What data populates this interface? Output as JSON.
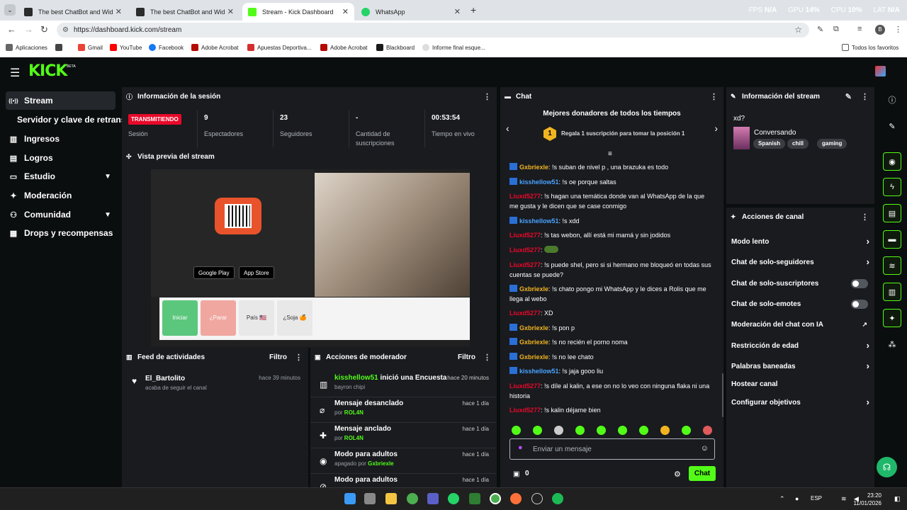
{
  "browser": {
    "tabs": [
      {
        "title": "The best ChatBot and Widgets",
        "icon_color": "#2b2b2b",
        "active": false
      },
      {
        "title": "The best ChatBot and Widgets",
        "icon_color": "#2b2b2b",
        "active": false
      },
      {
        "title": "Stream - Kick Dashboard",
        "icon_color": "#53fc18",
        "active": true
      },
      {
        "title": "WhatsApp",
        "icon_color": "#25d366",
        "active": false
      }
    ],
    "perf": {
      "fps_label": "FPS",
      "fps_val": "N/A",
      "gpu_label": "GPU",
      "gpu_val": "14%",
      "cpu_label": "CPU",
      "cpu_val": "10%",
      "lat_label": "LAT",
      "lat_val": "N/A"
    },
    "url": "https://dashboard.kick.com/stream",
    "profile_letter": "B",
    "bookmarks": [
      "Aplicaciones",
      "Gmail",
      "YouTube",
      "Facebook",
      "Adobe Acrobat",
      "Apuestas Deportiva...",
      "Adobe Acrobat",
      "Blackboard",
      "Informe final esque..."
    ],
    "bookmarks_all": "Todos los favoritos"
  },
  "app": {
    "logo": "KICK",
    "beta": "BETA",
    "sidebar": [
      {
        "label": "Stream",
        "icon": "stream-icon",
        "glyph": "((•))",
        "active": true
      },
      {
        "label": "Servidor y clave de retransmisión",
        "icon": "",
        "glyph": "",
        "active": false
      },
      {
        "label": "Ingresos",
        "icon": "income-icon",
        "glyph": "▥",
        "active": false
      },
      {
        "label": "Logros",
        "icon": "achievements-icon",
        "glyph": "▤",
        "active": false
      },
      {
        "label": "Estudio",
        "icon": "studio-icon",
        "glyph": "▭",
        "active": false,
        "chevron": "⌄"
      },
      {
        "label": "Moderación",
        "icon": "moderation-icon",
        "glyph": "🔧",
        "active": false
      },
      {
        "label": "Comunidad",
        "icon": "community-icon",
        "glyph": "👥",
        "active": false,
        "chevron": "⌄"
      },
      {
        "label": "Drops y recompensas",
        "icon": "drops-icon",
        "glyph": "▦",
        "active": false
      }
    ],
    "session": {
      "title": "Información de la sesión",
      "live_badge": "TRANSMITIENDO",
      "live_label": "Sesión",
      "stats": [
        {
          "value": "9",
          "label": "Espectadores"
        },
        {
          "value": "23",
          "label": "Seguidores"
        },
        {
          "value": "-",
          "label": "Cantidad de suscripciones"
        },
        {
          "value": "00:53:54",
          "label": "Tiempo en vivo"
        }
      ]
    },
    "preview": {
      "title": "Vista previa del stream",
      "buttons": [
        "Iniciar",
        "¿Parar",
        "País 🇺🇸",
        "¿Soja 🍊"
      ],
      "store1": "Google Play",
      "store2": "App Store"
    },
    "feed": {
      "title": "Feed de actividades",
      "filter": "Filtro",
      "items": [
        {
          "user": "El_Bartolito",
          "sub": "acaba de seguir el canal",
          "when": "hace 39 minutos"
        }
      ]
    },
    "moderator": {
      "title": "Acciones de moderador",
      "filter": "Filtro",
      "items": [
        {
          "icon": "poll-icon",
          "glyph": "▥",
          "user": "kisshellow51",
          "title": " inició una Encuesta",
          "sub_prefix": "",
          "sub_user": "",
          "sub_plain": "bayron chipi",
          "when": "hace 20 minutos"
        },
        {
          "icon": "unpin-icon",
          "glyph": "⌀",
          "user": "",
          "title": "Mensaje desanclado",
          "sub_prefix": "por ",
          "sub_user": "ROL4N",
          "sub_plain": "",
          "when": "hace 1 día"
        },
        {
          "icon": "pin-icon",
          "glyph": "📌",
          "user": "",
          "title": "Mensaje anclado",
          "sub_prefix": "por ",
          "sub_user": "ROL4N",
          "sub_plain": "",
          "when": "hace 1 día"
        },
        {
          "icon": "eye-icon",
          "glyph": "👁",
          "user": "",
          "title": "Modo para adultos",
          "sub_prefix": "apagado por ",
          "sub_user": "Gxbriexle",
          "sub_plain": "",
          "when": "hace 1 día"
        },
        {
          "icon": "eye-off-icon",
          "glyph": "⊘",
          "user": "",
          "title": "Modo para adultos",
          "sub_prefix": "",
          "sub_user": "",
          "sub_plain": "",
          "when": "hace 1 día"
        }
      ]
    },
    "chat": {
      "title": "Chat",
      "donors_title": "Mejores donadores de todos los tiempos",
      "donor_rank": "1",
      "donor_text": "Regala 1 suscripción para tomar la posición 1",
      "messages": [
        {
          "user": "Gxbriexle",
          "color": "#f1b421",
          "badge": true,
          "text": ": !s suban de nivel p , una brazuka es todo"
        },
        {
          "user": "kisshellow51",
          "color": "#4aa3ff",
          "badge": true,
          "text": ": !s oe porque saltas"
        },
        {
          "user": "Liuxd5277",
          "color": "#e8092a",
          "badge": false,
          "text": ": !s hagan una temática donde van al WhatsApp de la que me gusta y le dicen que se case conmigo"
        },
        {
          "user": "kisshellow51",
          "color": "#4aa3ff",
          "badge": true,
          "text": ": !s xdd"
        },
        {
          "user": "Liuxd5277",
          "color": "#e8092a",
          "badge": false,
          "text": ": !s tas webon, allí está mi mamá y sin jodidos"
        },
        {
          "user": "Liuxd5277",
          "color": "#e8092a",
          "badge": false,
          "text": ": ",
          "emote": true
        },
        {
          "user": "Liuxd5277",
          "color": "#e8092a",
          "badge": false,
          "text": ": !s puede shel, pero si si hermano me bloqueó en todas sus cuentas se puede?"
        },
        {
          "user": "Gxbriexle",
          "color": "#f1b421",
          "badge": true,
          "text": ": !s chato pongo mi WhatsApp y le dices a Rolis que me llega al webo"
        },
        {
          "user": "Liuxd5277",
          "color": "#e8092a",
          "badge": false,
          "text": ": XD"
        },
        {
          "user": "Gxbriexle",
          "color": "#f1b421",
          "badge": true,
          "text": ": !s pon p"
        },
        {
          "user": "Gxbriexle",
          "color": "#f1b421",
          "badge": true,
          "text": ": !s no recién el porno noma"
        },
        {
          "user": "Gxbriexle",
          "color": "#f1b421",
          "badge": true,
          "text": ": !s no lee chato"
        },
        {
          "user": "kisshellow51",
          "color": "#4aa3ff",
          "badge": true,
          "text": ": !s jaja gooo liu"
        },
        {
          "user": "Liuxd5277",
          "color": "#e8092a",
          "badge": false,
          "text": ": !s díle al kalin, a ese on no lo veo con ninguna flaka ni una historia"
        },
        {
          "user": "Liuxd5277",
          "color": "#e8092a",
          "badge": false,
          "text": ": !s kalin déjame bien"
        }
      ],
      "input_placeholder": "Enviar un mensaje",
      "points": "0",
      "send_label": "Chat"
    },
    "stream_info": {
      "title": "Información del stream",
      "stream_title": "xd?",
      "category": "Conversando",
      "tags": [
        "Spanish",
        "chill",
        "gaming"
      ]
    },
    "channel_actions": {
      "title": "Acciones de canal",
      "items": [
        {
          "label": "Modo lento",
          "kind": "chevron"
        },
        {
          "label": "Chat de solo-seguidores",
          "kind": "chevron"
        },
        {
          "label": "Chat de solo-suscriptores",
          "kind": "toggle"
        },
        {
          "label": "Chat de solo-emotes",
          "kind": "toggle"
        },
        {
          "label": "Moderación del chat con IA",
          "kind": "external"
        },
        {
          "label": "Restricción de edad",
          "kind": "chevron"
        },
        {
          "label": "Palabras baneadas",
          "kind": "chevron"
        },
        {
          "label": "Hostear canal",
          "kind": "none"
        },
        {
          "label": "Configurar objetivos",
          "kind": "chevron"
        }
      ]
    }
  },
  "taskbar": {
    "lang": "ESP",
    "time": "23:20",
    "date": "11/01/2026"
  }
}
